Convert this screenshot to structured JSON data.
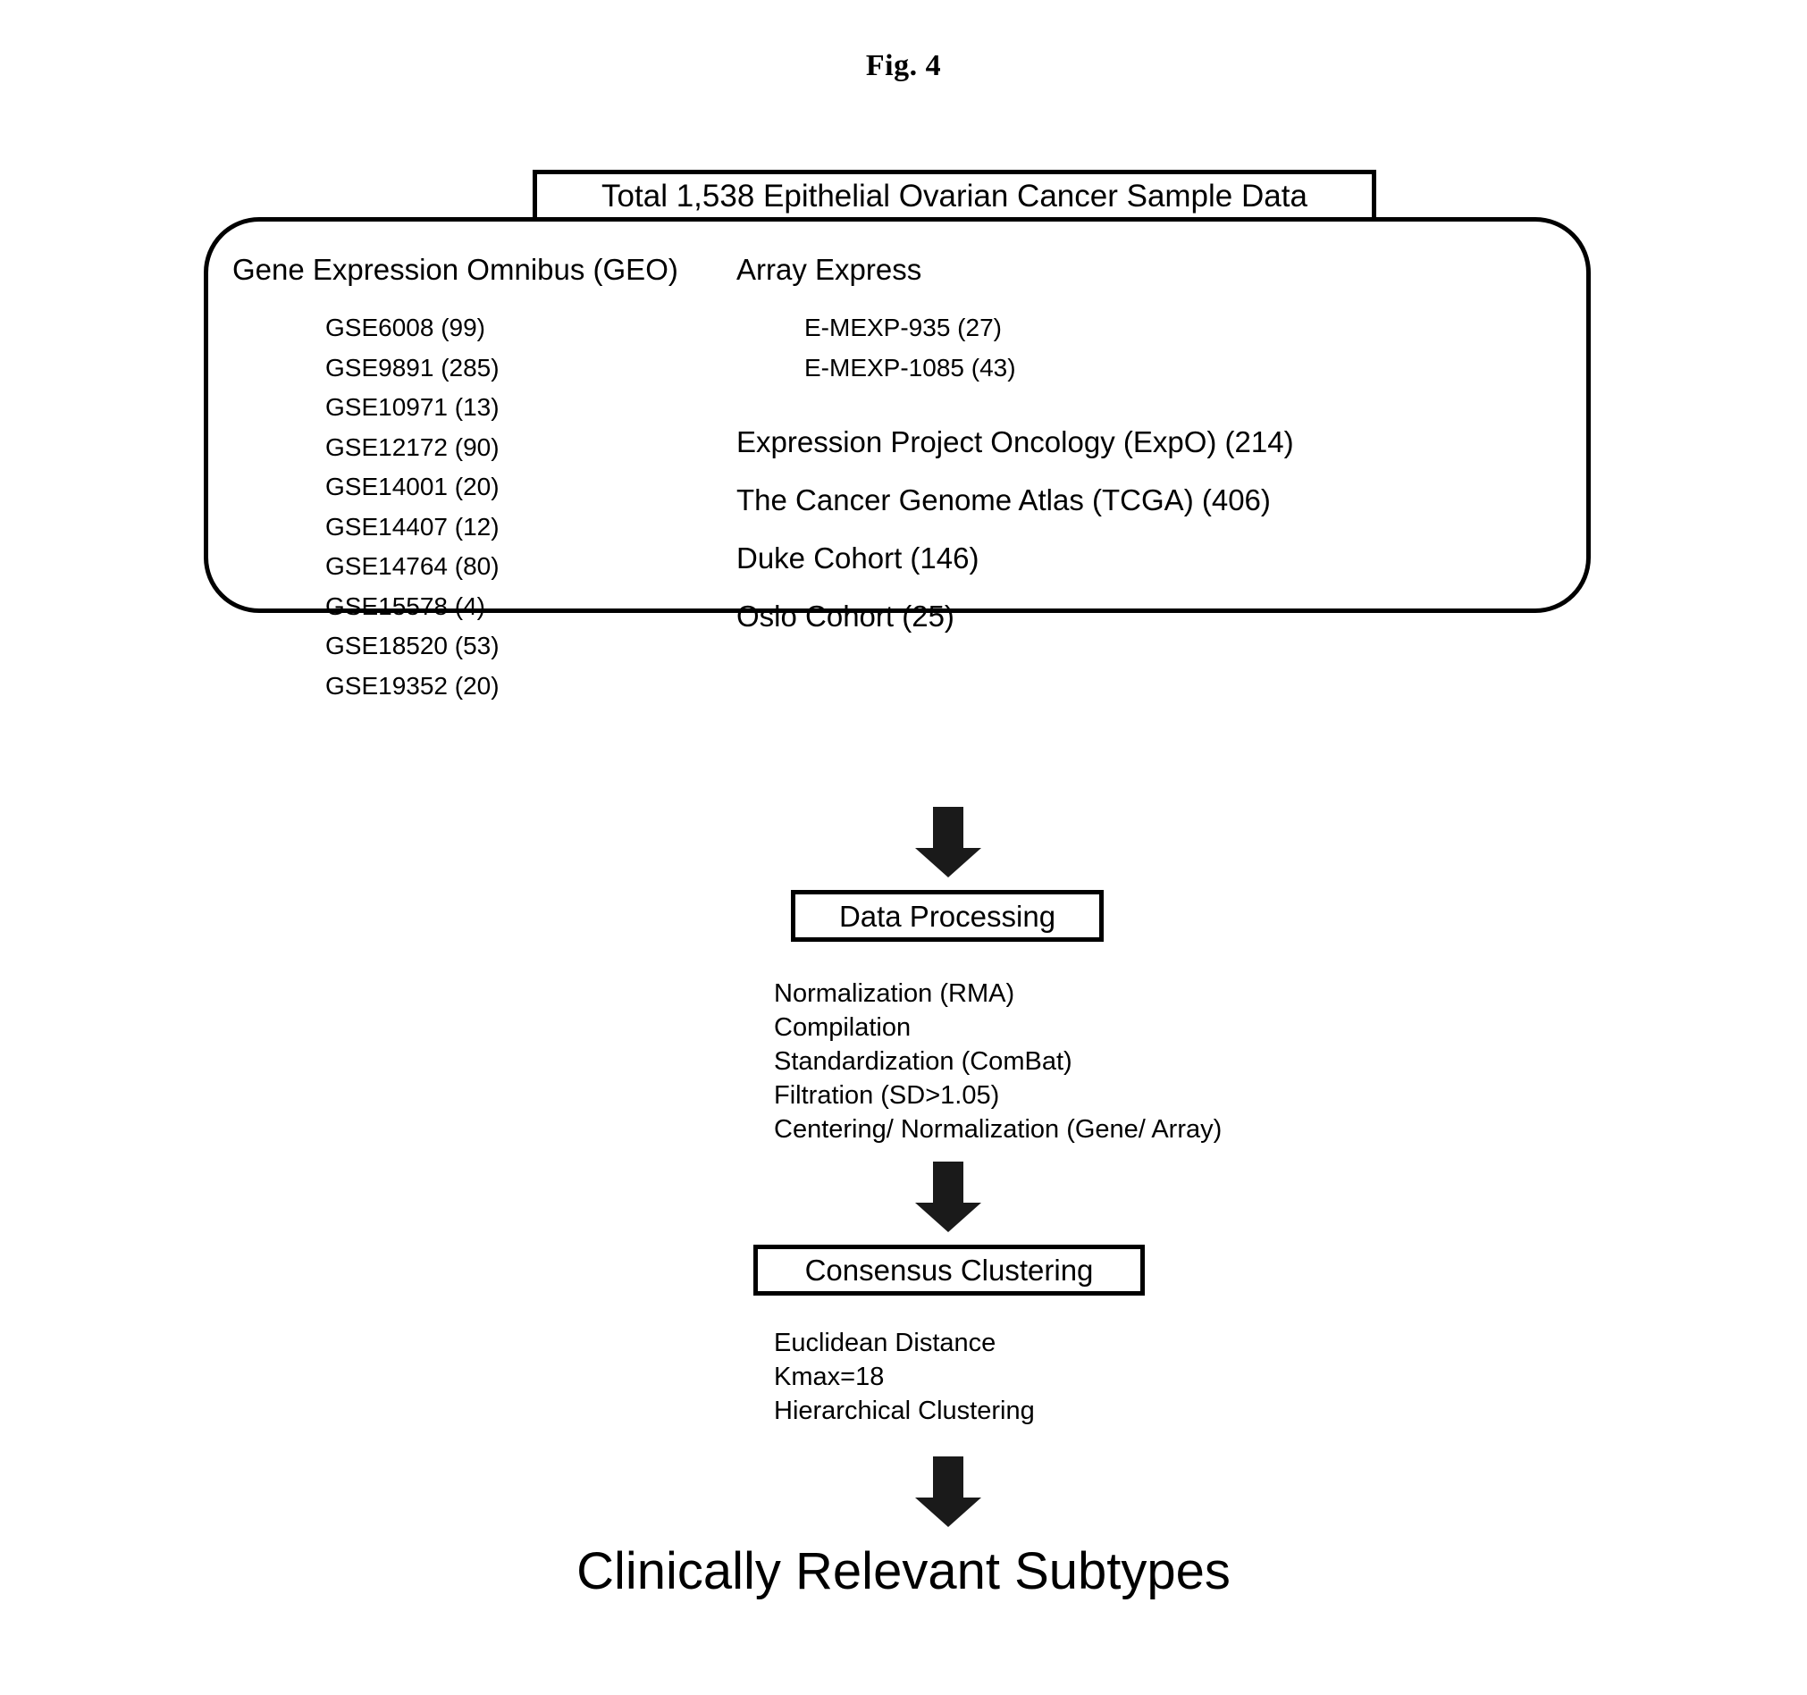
{
  "figure": {
    "title": "Fig. 4"
  },
  "header_box": {
    "label": "Total 1,538 Epithelial Ovarian Cancer Sample Data"
  },
  "sources": {
    "left_column": {
      "heading": "Gene Expression Omnibus (GEO)",
      "items": [
        "GSE6008 (99)",
        "GSE9891 (285)",
        "GSE10971 (13)",
        "GSE12172 (90)",
        "GSE14001 (20)",
        "GSE14407 (12)",
        "GSE14764 (80)",
        "GSE15578 (4)",
        "GSE18520 (53)",
        "GSE19352 (20)"
      ]
    },
    "right_column": {
      "heading": "Array Express",
      "items": [
        "E-MEXP-935 (27)",
        "E-MEXP-1085 (43)"
      ],
      "other_sources": [
        "Expression Project Oncology (ExpO) (214)",
        "The Cancer Genome Atlas (TCGA) (406)",
        "Duke Cohort (146)",
        "Oslo Cohort (25)"
      ]
    }
  },
  "data_processing": {
    "box_label": "Data Processing",
    "steps": [
      "Normalization (RMA)",
      "Compilation",
      "Standardization (ComBat)",
      "Filtration (SD>1.05)",
      "Centering/ Normalization (Gene/ Array)"
    ]
  },
  "consensus_clustering": {
    "box_label": "Consensus Clustering",
    "steps": [
      "Euclidean Distance",
      "Kmax=18",
      "Hierarchical Clustering"
    ]
  },
  "outcome": {
    "label": "Clinically Relevant Subtypes"
  },
  "colors": {
    "stroke": "#000000",
    "background": "#ffffff"
  },
  "icons": {
    "arrow_down": "down-arrow-icon"
  }
}
